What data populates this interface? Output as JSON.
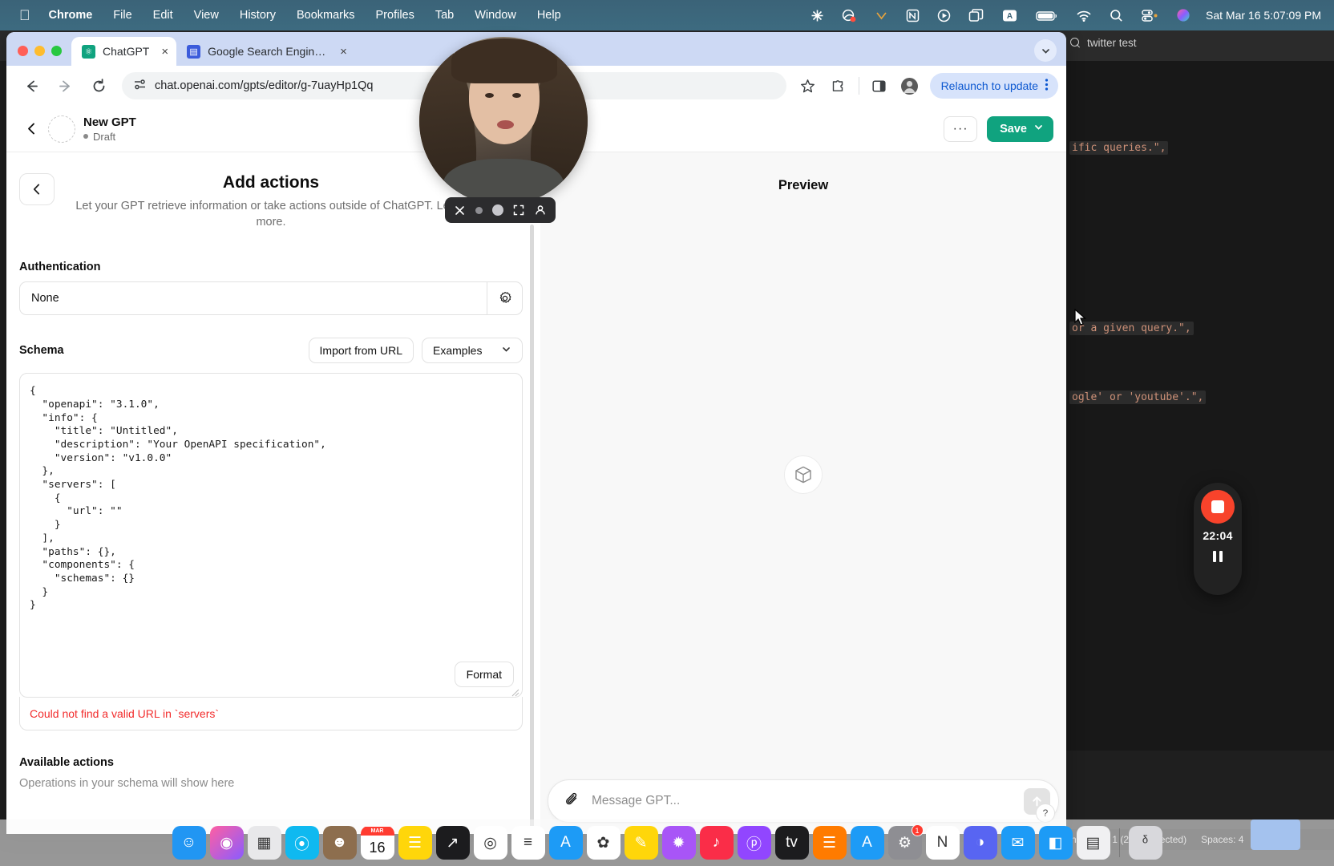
{
  "menubar": {
    "apple_icon": "apple-logo",
    "items": [
      "Chrome",
      "File",
      "Edit",
      "View",
      "History",
      "Bookmarks",
      "Profiles",
      "Tab",
      "Window",
      "Help"
    ],
    "tray_icons": [
      "asterisk-icon",
      "cleanshot-icon",
      "yelp-icon",
      "notion-icon",
      "play-circle-icon",
      "windows-icon",
      "keyboard-a-icon",
      "battery-icon",
      "wifi-icon",
      "search-icon",
      "control-center-icon",
      "siri-icon"
    ],
    "clock": "Sat Mar 16  5:07:09 PM"
  },
  "chrome": {
    "tabs": [
      {
        "title": "ChatGPT",
        "favicon": "chatgpt-icon",
        "active": true,
        "close": "×"
      },
      {
        "title": "Google Search Engine Results",
        "favicon": "serp-icon",
        "active": false,
        "close": "×"
      }
    ],
    "tab_list_chevron": "chevron-down-icon",
    "toolbar": {
      "back_icon": "back-arrow-icon",
      "forward_icon": "forward-arrow-icon",
      "reload_icon": "reload-icon",
      "site_info_icon": "site-settings-icon",
      "url": "chat.openai.com/gpts/editor/g-7uayHp1Qq",
      "bookmark_icon": "star-icon",
      "extensions_icon": "puzzle-piece-icon",
      "side_panel_icon": "side-panel-icon",
      "profile_icon": "profile-avatar",
      "relaunch_label": "Relaunch to update",
      "relaunch_menu_icon": "kebab-menu-icon"
    }
  },
  "gpt_editor": {
    "header": {
      "back_icon": "chevron-left-icon",
      "avatar": "gpt-avatar-placeholder",
      "name": "New GPT",
      "status": "Draft",
      "more_label": "···",
      "save_label": "Save",
      "save_chevron": "chevron-down-icon",
      "save_color": "#10a37f"
    },
    "actions": {
      "back_icon": "chevron-left-icon",
      "title": "Add actions",
      "subtitle": "Let your GPT retrieve information or take actions outside of ChatGPT.",
      "learn_more": "Learn more."
    },
    "authentication": {
      "label": "Authentication",
      "value": "None",
      "gear_icon": "gear-icon"
    },
    "schema": {
      "label": "Schema",
      "import_label": "Import from URL",
      "examples_label": "Examples",
      "examples_chevron": "chevron-down-icon",
      "code": "{\n  \"openapi\": \"3.1.0\",\n  \"info\": {\n    \"title\": \"Untitled\",\n    \"description\": \"Your OpenAPI specification\",\n    \"version\": \"v1.0.0\"\n  },\n  \"servers\": [\n    {\n      \"url\": \"\"\n    }\n  ],\n  \"paths\": {},\n  \"components\": {\n    \"schemas\": {}\n  }\n}",
      "format_label": "Format",
      "error": "Could not find a valid URL in `servers`",
      "error_color": "#f22c2c"
    },
    "available_actions": {
      "label": "Available actions",
      "empty_text": "Operations in your schema will show here"
    }
  },
  "preview": {
    "title": "Preview",
    "placeholder_icon": "cube-icon",
    "composer": {
      "attach_icon": "paperclip-icon",
      "placeholder": "Message GPT...",
      "send_icon": "arrow-up-icon"
    },
    "help_badge": "?"
  },
  "vscode": {
    "search_icon": "search-icon",
    "search_text": "twitter test",
    "code_fragments": [
      "ific queries.\",",
      "or a given query.\",",
      "ogle' or 'youtube'.\","
    ],
    "cursor_icon": "mouse-pointer-icon",
    "statusbar": {
      "position": "n 94, Col 1 (2477 selected)",
      "spaces": "Spaces: 4"
    },
    "code_color": "#ce9178"
  },
  "recorder": {
    "stop_icon": "stop-square-icon",
    "time": "22:04",
    "pause_icon": "pause-icon",
    "accent": "#f8432b"
  },
  "webcam": {
    "label": "webcam-bubble",
    "controls": [
      "close-icon",
      "small-dot-icon",
      "large-dot-icon",
      "fullscreen-icon",
      "person-icon"
    ]
  },
  "dock": {
    "items": [
      {
        "name": "finder",
        "glyph": "☺",
        "bg": "#2196f3"
      },
      {
        "name": "siri",
        "glyph": "◉",
        "bg": "linear-gradient(135deg,#ff5fa2,#8a5cff)"
      },
      {
        "name": "launchpad",
        "glyph": "▦",
        "bg": "#e8e8ea"
      },
      {
        "name": "safari",
        "glyph": "⦿",
        "bg": "#0fb9f0"
      },
      {
        "name": "contacts",
        "glyph": "☻",
        "bg": "#8d6e4e"
      },
      {
        "name": "calendar",
        "glyph": "16",
        "bg": "#ffffff"
      },
      {
        "name": "notes",
        "glyph": "☰",
        "bg": "#ffd60a"
      },
      {
        "name": "stocks",
        "glyph": "↗",
        "bg": "#1c1c1e"
      },
      {
        "name": "chrome",
        "glyph": "◎",
        "bg": "#ffffff"
      },
      {
        "name": "reminders",
        "glyph": "≡",
        "bg": "#ffffff"
      },
      {
        "name": "appstore-alt",
        "glyph": "A",
        "bg": "#1d9bf6"
      },
      {
        "name": "photos",
        "glyph": "✿",
        "bg": "#ffffff"
      },
      {
        "name": "freeform",
        "glyph": "✎",
        "bg": "#ffd60a"
      },
      {
        "name": "iphoto",
        "glyph": "✹",
        "bg": "#a855f7"
      },
      {
        "name": "music",
        "glyph": "♪",
        "bg": "#fa2d48"
      },
      {
        "name": "podcasts",
        "glyph": "ⓟ",
        "bg": "#9146ff"
      },
      {
        "name": "appletv",
        "glyph": "tv",
        "bg": "#1c1c1e"
      },
      {
        "name": "books",
        "glyph": "☰",
        "bg": "#ff7b00"
      },
      {
        "name": "appstore",
        "glyph": "A",
        "bg": "#1d9bf6"
      },
      {
        "name": "settings",
        "glyph": "⚙",
        "bg": "#8e8e93",
        "badge": "1"
      },
      {
        "name": "notion",
        "glyph": "N",
        "bg": "#ffffff"
      },
      {
        "name": "discord",
        "glyph": "◑",
        "bg": "#5865f2"
      },
      {
        "name": "mail",
        "glyph": "✉",
        "bg": "#1d9bf6"
      },
      {
        "name": "vscode",
        "glyph": "◧",
        "bg": "#1d9bf6"
      },
      {
        "name": "preview",
        "glyph": "▤",
        "bg": "#f0f0f2"
      },
      {
        "name": "trash",
        "glyph": "ᵟ",
        "bg": "#d8d8dc"
      }
    ]
  }
}
